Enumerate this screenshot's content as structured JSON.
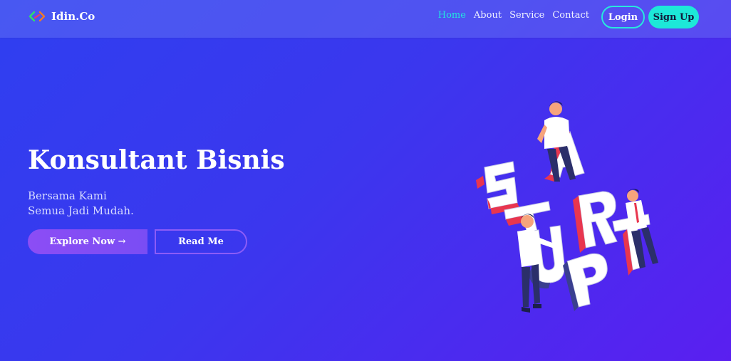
{
  "navbar": {
    "brand": "Idin.Co",
    "links": [
      {
        "label": "Home",
        "active": true
      },
      {
        "label": "About",
        "active": false
      },
      {
        "label": "Service",
        "active": false
      },
      {
        "label": "Contact",
        "active": false
      }
    ],
    "login_label": "Login",
    "signup_label": "Sign Up"
  },
  "hero": {
    "title": "Konsultant Bisnis",
    "subtitle_line1": "Bersama Kami",
    "subtitle_line2": "Semua Jadi Mudah.",
    "explore_label": "Explore Now →",
    "read_label": "Read Me"
  },
  "illustration": {
    "letters": [
      "S",
      "T",
      "A",
      "R",
      "T",
      "U",
      "P"
    ]
  },
  "colors": {
    "accent": "#1de8d8",
    "active_link": "#22e6e0",
    "primary_button": "#8c4df5",
    "letter_red": "#e8364f"
  },
  "icons": {
    "brand": "code-brackets-icon"
  }
}
